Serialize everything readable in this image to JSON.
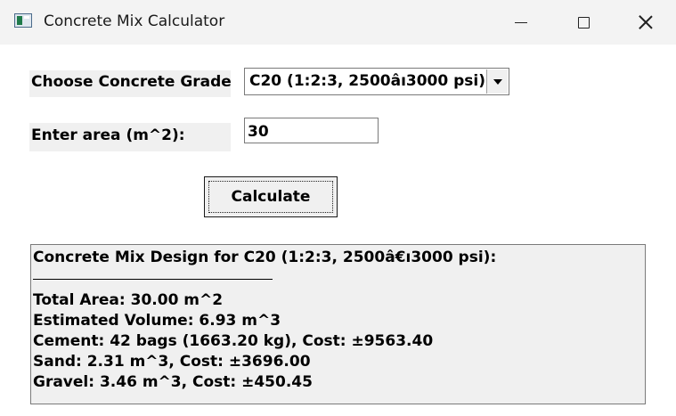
{
  "window": {
    "title": "Concrete Mix Calculator",
    "icon": "app-window-icon",
    "controls": {
      "minimize": "minimize-icon",
      "maximize": "maximize-icon",
      "close": "close-icon"
    }
  },
  "form": {
    "grade_label": "Choose Concrete Grade:",
    "grade_selected": "C20 (1:2:3, 2500âı3000 psi)",
    "area_label": "Enter area (m^2):",
    "area_value": "30",
    "calculate_label": "Calculate"
  },
  "results": {
    "heading": "Concrete Mix Design for C20 (1:2:3, 2500â€ı3000 psi):",
    "lines": [
      "Total Area: 30.00 m^2",
      "Estimated Volume: 6.93 m^3",
      "Cement: 42 bags (1663.20 kg), Cost: ±9563.40",
      "Sand: 2.31 m^3, Cost: ±3696.00",
      "Gravel: 3.46 m^3, Cost: ±450.45"
    ]
  },
  "colors": {
    "titlebar_bg": "#f3f3f3",
    "control_bg": "#f0f0f0",
    "window_bg": "#ffffff"
  }
}
